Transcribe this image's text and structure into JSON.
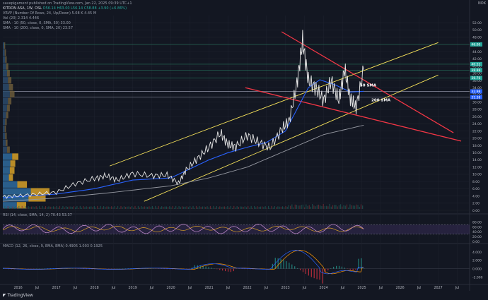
{
  "header": {
    "publisher": "savepigament published on TradingView.com, Jan 22, 2025 09:39 UTC+1",
    "symbol_line": "KITRON ASA, 1W, OSL",
    "ohlc": "O56.14 H63.00 L56.14 C58.88 +3.90 (+6.86%)",
    "vrvp": "VRVP (Number Of Rows, 24, Up/Down)  5.08 K  4.45 M",
    "vol": "Vol (20)  2.314  4.446",
    "sma50": "SMA · 10 (50, close, 0, SMA, 50)  33.00",
    "sma200": "SMA · 10 (200, close, 0, SMA, 20)  23.57"
  },
  "currency": "NOK",
  "rsi_label": "RSI (14, close, SMA, 14, 2)  70.43  53.37",
  "macd_label": "MACD (12, 26, close, 9, EMA, EMA)  0.4905  1.003  0.1925",
  "annotations": {
    "sma50": "50 SMA",
    "sma200": "200 SMA"
  },
  "footer": {
    "brand": "TradingView"
  },
  "colors": {
    "price": "#e6e6e6",
    "sma50": "#2962ff",
    "sma200": "#9598a1",
    "channel": "#f7e35a",
    "wedge": "#f23645",
    "rsi": "#ce93d8",
    "macd": "#2962ff",
    "signal": "#ff9800"
  },
  "chart_data": {
    "type": "line",
    "title": "KITRON ASA, 1W, OSL",
    "ylim": [
      0,
      54
    ],
    "y_ticks": [
      0,
      2,
      4,
      6,
      8,
      10,
      12,
      14,
      16,
      18,
      20,
      22,
      24,
      26,
      28,
      30,
      32,
      34,
      36,
      38,
      40,
      42,
      44,
      46,
      48,
      50,
      52
    ],
    "price_labels": [
      {
        "value": 46.0,
        "color": "#26a69a"
      },
      {
        "value": 40.52,
        "color": "#26a69a"
      },
      {
        "value": 38.88,
        "color": "#26a69a"
      },
      {
        "value": 36.7,
        "color": "#26a69a"
      },
      {
        "value": 32.98,
        "color": "#2962ff"
      },
      {
        "value": 31.38,
        "color": "#2962ff"
      }
    ],
    "x_ticks": [
      "2016",
      "Jul",
      "2017",
      "Jul",
      "2018",
      "Jul",
      "2019",
      "Jul",
      "2020",
      "Jul",
      "2021",
      "Jul",
      "2022",
      "Jul",
      "2023",
      "Jul",
      "2024",
      "Jul",
      "2025",
      "Jul",
      "2026",
      "Jul",
      "2027",
      "Jul"
    ],
    "x_range": [
      2015.6,
      2027.6
    ],
    "price": {
      "x": [
        2015.6,
        2016.0,
        2016.5,
        2017.0,
        2017.5,
        2018.0,
        2018.3,
        2018.6,
        2019.0,
        2019.5,
        2019.9,
        2020.2,
        2020.4,
        2020.7,
        2021.0,
        2021.3,
        2021.5,
        2021.7,
        2022.0,
        2022.3,
        2022.6,
        2022.9,
        2023.1,
        2023.3,
        2023.45,
        2023.6,
        2023.8,
        2024.0,
        2024.2,
        2024.4,
        2024.55,
        2024.7,
        2024.85,
        2025.05
      ],
      "y": [
        3.8,
        4.0,
        4.5,
        5.0,
        7.4,
        8.8,
        9.6,
        8.4,
        10.2,
        9.6,
        9.8,
        7.5,
        11.2,
        14.4,
        17.5,
        21.4,
        18.2,
        17.6,
        20.8,
        18.8,
        17.4,
        22.4,
        25.0,
        35.0,
        47.0,
        36.0,
        33.8,
        30.5,
        36.0,
        30.5,
        39.2,
        31.0,
        28.5,
        38.9
      ]
    },
    "sma50": {
      "x": [
        2015.6,
        2017.0,
        2018.0,
        2019.0,
        2020.0,
        2020.5,
        2021.0,
        2021.5,
        2022.0,
        2022.5,
        2023.0,
        2023.3,
        2023.6,
        2023.9,
        2024.3,
        2024.7,
        2025.05
      ],
      "y": [
        3.5,
        4.5,
        6.0,
        8.4,
        9.0,
        11.5,
        14.0,
        16.0,
        17.5,
        18.8,
        22.0,
        28.0,
        34.0,
        36.2,
        34.8,
        32.8,
        33.0
      ]
    },
    "sma200": {
      "x": [
        2015.6,
        2017.0,
        2018.5,
        2020.0,
        2021.0,
        2022.0,
        2023.0,
        2024.0,
        2025.05
      ],
      "y": [
        2.5,
        3.4,
        5.0,
        6.8,
        9.0,
        12.0,
        16.5,
        21.0,
        23.6
      ]
    },
    "trendlines": [
      {
        "name": "channel-upper",
        "color": "#f7e35a",
        "x": [
          2018.4,
          2027.0
        ],
        "y": [
          12.3,
          46.5
        ]
      },
      {
        "name": "channel-lower",
        "color": "#f7e35a",
        "x": [
          2019.3,
          2027.0
        ],
        "y": [
          2.5,
          37.5
        ]
      },
      {
        "name": "wedge-upper",
        "color": "#f23645",
        "x": [
          2022.9,
          2027.4
        ],
        "y": [
          49.5,
          21.5
        ]
      },
      {
        "name": "wedge-lower",
        "color": "#f23645",
        "x": [
          2021.95,
          2027.6
        ],
        "y": [
          34.0,
          19.2
        ]
      }
    ],
    "rsi": {
      "ylim": [
        0,
        100
      ],
      "y_ticks": [
        0,
        20,
        40,
        60,
        80
      ],
      "band": [
        30,
        70
      ]
    },
    "macd": {
      "y_ticks": [
        -2,
        0,
        2,
        4
      ],
      "ylim": [
        -2.6,
        5.2
      ]
    },
    "volume_profile_rows": 24
  }
}
